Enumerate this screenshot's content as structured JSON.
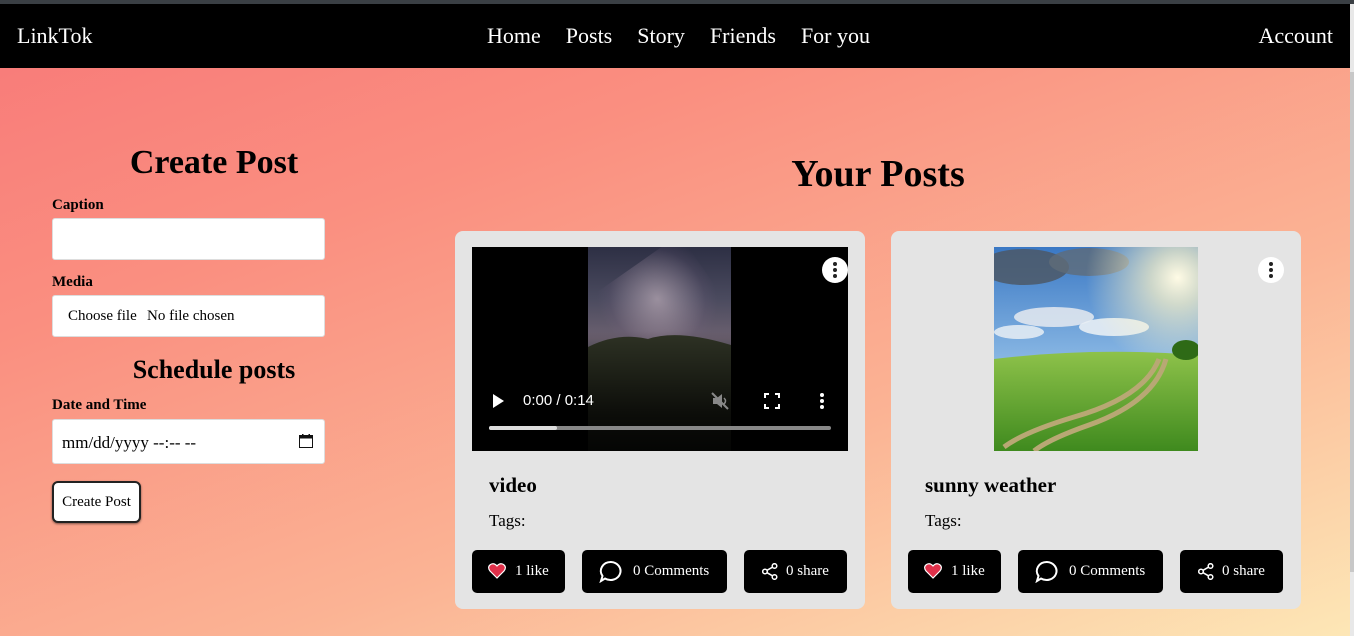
{
  "navbar": {
    "brand": "LinkTok",
    "links": [
      "Home",
      "Posts",
      "Story",
      "Friends",
      "For you"
    ],
    "account": "Account"
  },
  "create_post": {
    "title": "Create Post",
    "caption_label": "Caption",
    "caption_value": "",
    "media_label": "Media",
    "file_button": "Choose file",
    "file_status": "No file chosen",
    "schedule_title": "Schedule posts",
    "datetime_label": "Date and Time",
    "datetime_placeholder": "mm/dd/yyyy --:-- --",
    "submit_label": "Create Post"
  },
  "posts_section": {
    "title": "Your Posts",
    "posts": [
      {
        "media_type": "video",
        "video_time": "0:00 / 0:14",
        "video_progress": 0.2,
        "title": "video",
        "tags_label": "Tags:",
        "like_label": "1 like",
        "comments_label": "0 Comments",
        "share_label": "0 share"
      },
      {
        "media_type": "image",
        "title": "sunny weather",
        "tags_label": "Tags:",
        "like_label": "1 like",
        "comments_label": "0 Comments",
        "share_label": "0 share"
      }
    ]
  },
  "colors": {
    "navbar": "#000000",
    "card": "#e4e4e4",
    "button": "#000000",
    "heart": "#e0304a",
    "gradient_start": "#f87878",
    "gradient_end": "#fde7b6"
  },
  "icons": [
    "calendar-icon",
    "more-vert-icon",
    "heart-icon",
    "comment-icon",
    "share-icon",
    "play-icon",
    "mute-icon",
    "fullscreen-icon"
  ]
}
